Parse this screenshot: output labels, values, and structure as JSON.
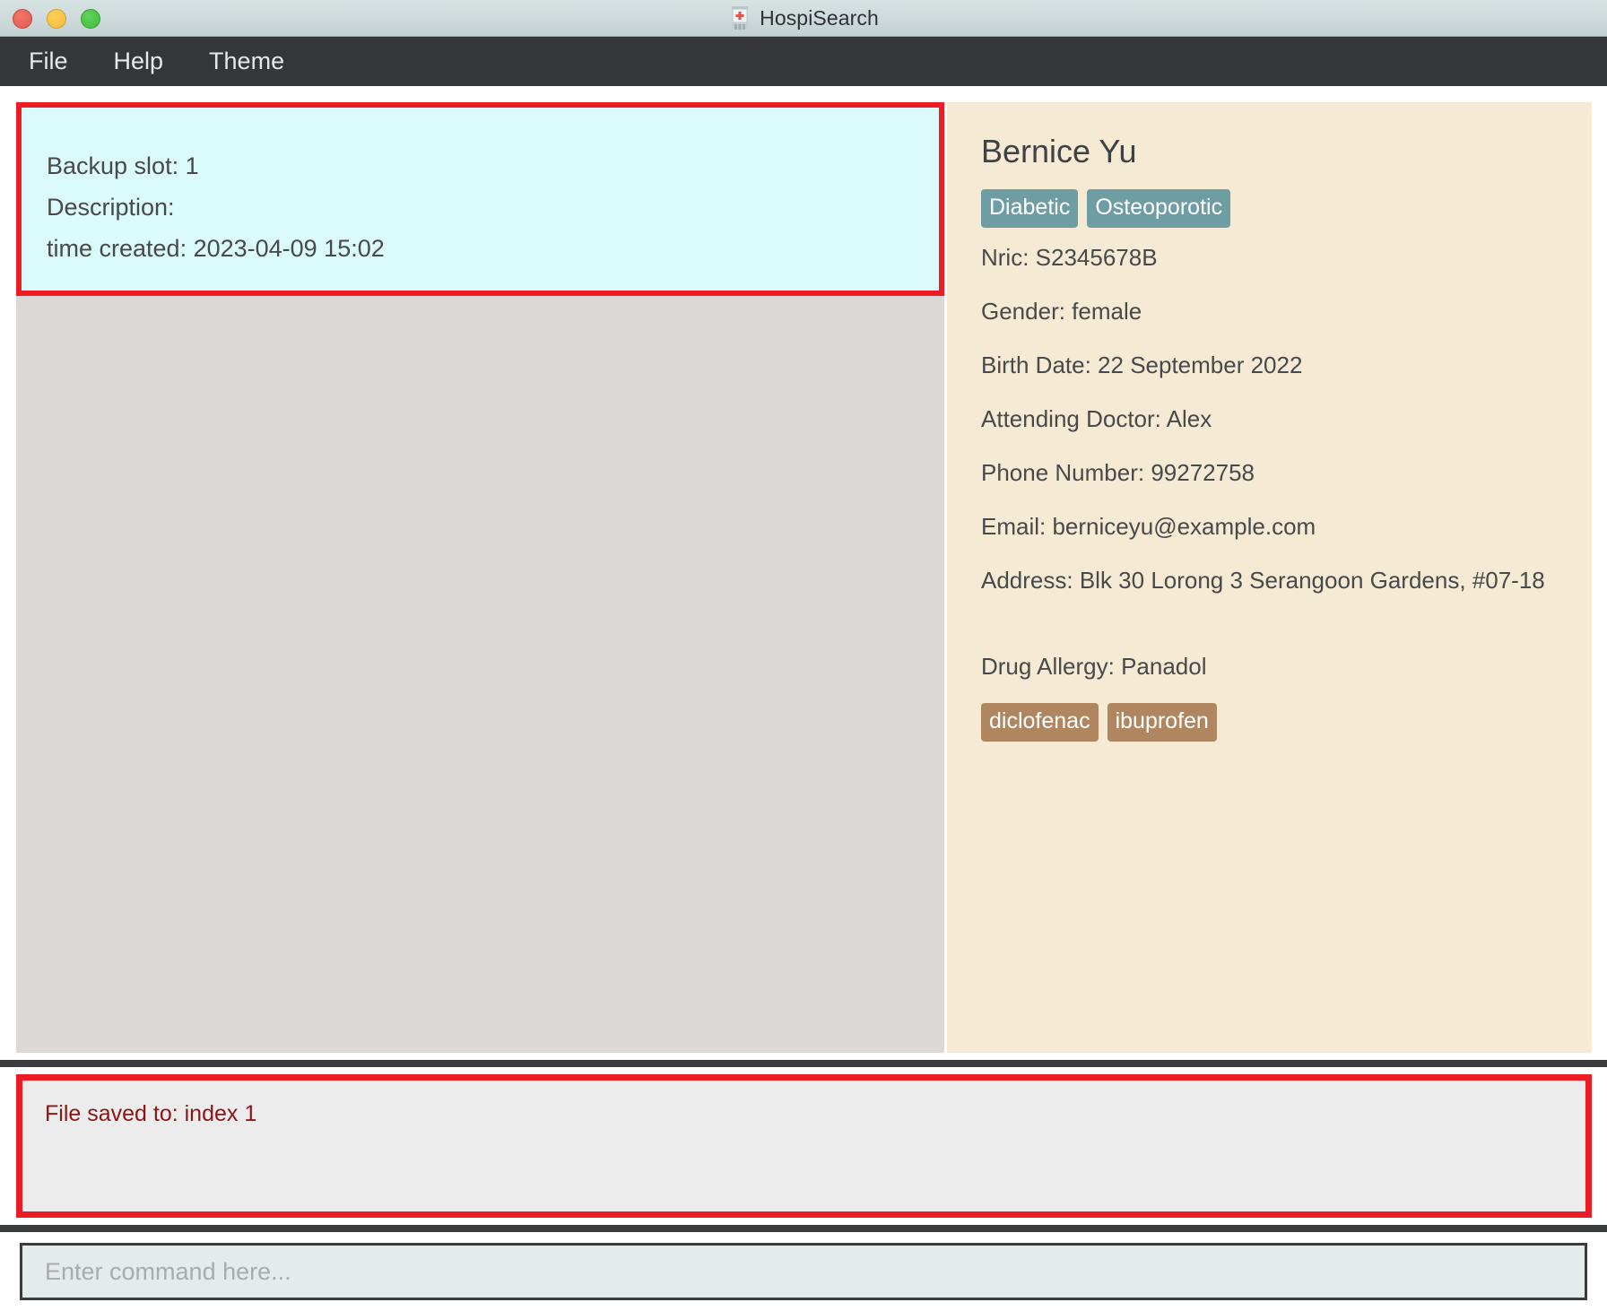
{
  "window": {
    "title": "HospiSearch",
    "icon": "hospital-icon",
    "controls": {
      "close": "close-button",
      "minimize": "minimize-button",
      "maximize": "maximize-button"
    }
  },
  "menubar": {
    "items": [
      {
        "label": "File"
      },
      {
        "label": "Help"
      },
      {
        "label": "Theme"
      }
    ]
  },
  "backup_card": {
    "slot_line": "Backup slot: 1",
    "description_line": "Description:",
    "time_created_line": "time created: 2023-04-09 15:02"
  },
  "patient": {
    "name": "Bernice Yu",
    "condition_tags": [
      "Diabetic",
      "Osteoporotic"
    ],
    "nric": "Nric: S2345678B",
    "gender": "Gender: female",
    "birth_date": "Birth Date: 22 September 2022",
    "attending_doctor": "Attending Doctor: Alex",
    "phone_number": "Phone Number: 99272758",
    "email": "Email: berniceyu@example.com",
    "address": "Address: Blk 30 Lorong 3 Serangoon Gardens, #07-18",
    "drug_allergy": "Drug Allergy: Panadol",
    "allergy_tags": [
      "diclofenac",
      "ibuprofen"
    ]
  },
  "result": {
    "message": "File saved to: index 1"
  },
  "command": {
    "value": "",
    "placeholder": "Enter command here..."
  },
  "colors": {
    "menubar": "#353638",
    "highlight_border": "#ed1c24",
    "backup_bg": "#dbfbfa",
    "filler_bg": "#dcd8d6",
    "patient_bg": "#f5ead3",
    "condition_tag": "#6e9ea4",
    "allergy_tag": "#b08660",
    "result_text": "#8c1515",
    "result_bg": "#ececec",
    "command_bg": "#e5eaea"
  }
}
